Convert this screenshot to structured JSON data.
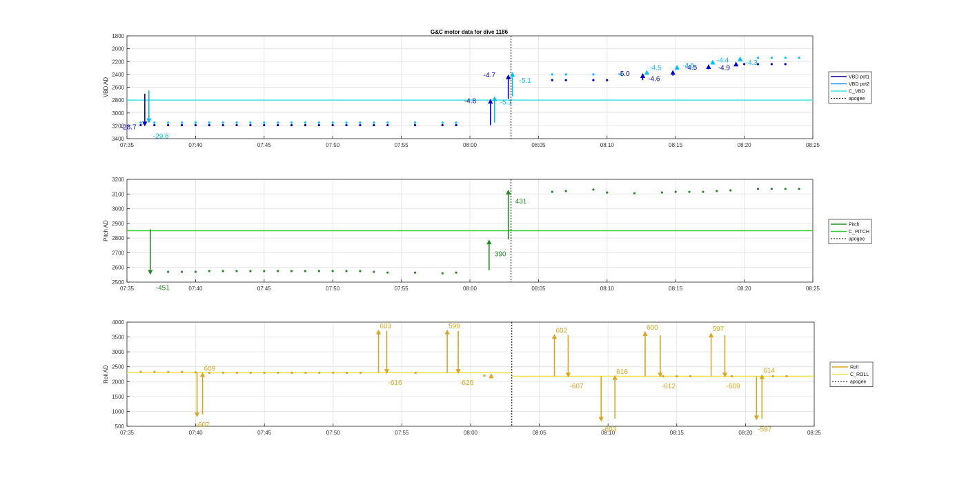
{
  "figure": {
    "title": "G&C motor data for dive 1186"
  },
  "colors": {
    "vbd_pot1": "#00008B",
    "vbd_pot2": "#1E90FF",
    "c_vbd": "#40E0E0",
    "vbd_marker": "#0000CD",
    "vbd_marker2": "#00BFFF",
    "pitch": "#228B22",
    "c_pitch": "#32CD32",
    "roll": "#DAA520",
    "c_roll": "#F5E050",
    "apogee": "#000000",
    "grid": "#e6e6e6",
    "axis": "#262626"
  },
  "chart_data": [
    {
      "type": "line",
      "id": "vbd",
      "ylabel": "VBD AD",
      "xlim": [
        "07:35",
        "08:25"
      ],
      "ylim": [
        1800,
        3400
      ],
      "yreverse": true,
      "xticks": [
        "07:35",
        "07:40",
        "07:45",
        "07:50",
        "07:55",
        "08:00",
        "08:05",
        "08:10",
        "08:15",
        "08:20",
        "08:25"
      ],
      "yticks": [
        1800,
        2000,
        2200,
        2400,
        2600,
        2800,
        3000,
        3200,
        3400
      ],
      "legend": {
        "position": "right",
        "entries": [
          "VBD pot1",
          "VBD pot2",
          "C_VBD",
          "apogee"
        ]
      },
      "reference_line": {
        "name": "C_VBD",
        "value": 2800
      },
      "apogee": "08:03",
      "points_pot1": [
        [
          "07:36",
          3190
        ],
        [
          "07:37",
          3190
        ],
        [
          "07:38",
          3190
        ],
        [
          "07:39",
          3190
        ],
        [
          "07:40",
          3190
        ],
        [
          "07:41",
          3190
        ],
        [
          "07:42",
          3190
        ],
        [
          "07:43",
          3190
        ],
        [
          "07:44",
          3190
        ],
        [
          "07:45",
          3190
        ],
        [
          "07:46",
          3190
        ],
        [
          "07:47",
          3190
        ],
        [
          "07:48",
          3190
        ],
        [
          "07:49",
          3190
        ],
        [
          "07:50",
          3190
        ],
        [
          "07:51",
          3190
        ],
        [
          "07:52",
          3190
        ],
        [
          "07:53",
          3190
        ],
        [
          "07:54",
          3190
        ],
        [
          "07:56",
          3190
        ],
        [
          "07:58",
          3190
        ],
        [
          "07:59",
          3190
        ],
        [
          "08:06",
          2490
        ],
        [
          "08:07",
          2490
        ],
        [
          "08:09",
          2490
        ],
        [
          "08:10",
          2490
        ],
        [
          "08:20",
          2240
        ],
        [
          "08:21",
          2240
        ],
        [
          "08:22",
          2240
        ],
        [
          "08:23",
          2240
        ]
      ],
      "points_pot2": [
        [
          "07:36",
          3150
        ],
        [
          "07:37",
          3150
        ],
        [
          "07:38",
          3150
        ],
        [
          "07:39",
          3150
        ],
        [
          "07:40",
          3150
        ],
        [
          "07:41",
          3150
        ],
        [
          "07:42",
          3150
        ],
        [
          "07:43",
          3150
        ],
        [
          "07:44",
          3150
        ],
        [
          "07:45",
          3150
        ],
        [
          "07:46",
          3150
        ],
        [
          "07:47",
          3150
        ],
        [
          "07:48",
          3150
        ],
        [
          "07:49",
          3150
        ],
        [
          "07:50",
          3150
        ],
        [
          "07:51",
          3150
        ],
        [
          "07:52",
          3150
        ],
        [
          "07:53",
          3150
        ],
        [
          "07:54",
          3150
        ],
        [
          "07:56",
          3150
        ],
        [
          "07:58",
          3150
        ],
        [
          "07:59",
          3150
        ],
        [
          "08:06",
          2400
        ],
        [
          "08:07",
          2400
        ],
        [
          "08:09",
          2400
        ],
        [
          "08:11",
          2400
        ],
        [
          "08:21",
          2140
        ],
        [
          "08:22",
          2140
        ],
        [
          "08:23",
          2140
        ],
        [
          "08:24",
          2140
        ]
      ],
      "arrows": [
        {
          "x": "07:36.3",
          "from": 2700,
          "to": 3210,
          "color": "vbd_marker",
          "label": "-28.7",
          "label_dx": -35,
          "label_dy": 4
        },
        {
          "x": "07:36.6",
          "from": 2650,
          "to": 3160,
          "color": "vbd_marker2",
          "label": "-29.6",
          "label_dx": 6,
          "label_dy": 22
        },
        {
          "x": "08:01.5",
          "from": 3190,
          "to": 2780,
          "color": "vbd_marker",
          "label": "-4.8",
          "label_dx": -38,
          "label_dy": 6
        },
        {
          "x": "08:01.8",
          "from": 3150,
          "to": 2740,
          "color": "vbd_marker2",
          "label": "-5.1",
          "label_dx": 8,
          "label_dy": 12
        },
        {
          "x": "08:02.8",
          "from": 2780,
          "to": 2400,
          "color": "vbd_marker",
          "label": "-4.7",
          "label_dx": -36,
          "label_dy": 4
        },
        {
          "x": "08:03.1",
          "from": 2740,
          "to": 2360,
          "color": "vbd_marker2",
          "label": "-5.1",
          "label_dx": 10,
          "label_dy": 16
        },
        {
          "x": "08:12.6",
          "from": 2490,
          "to": 2380,
          "color": "vbd_marker",
          "label": "-5.0",
          "label_dx": -36,
          "label_dy": 4
        },
        {
          "x": "08:12.9",
          "from": 2400,
          "to": 2330,
          "color": "vbd_marker2",
          "label": "-4.5",
          "label_dx": 4,
          "label_dy": 0
        },
        {
          "x": "08:14.8",
          "from": 2420,
          "to": 2330,
          "color": "vbd_marker",
          "label": "-4.6",
          "label_dx": -36,
          "label_dy": 16
        },
        {
          "x": "08:15.1",
          "from": 2330,
          "to": 2250,
          "color": "vbd_marker2",
          "label": "-4.5",
          "label_dx": 8,
          "label_dy": 4
        },
        {
          "x": "08:17.4",
          "from": 2320,
          "to": 2240,
          "color": "vbd_marker",
          "label": "-4.5",
          "label_dx": -34,
          "label_dy": 8
        },
        {
          "x": "08:17.7",
          "from": 2240,
          "to": 2170,
          "color": "vbd_marker2",
          "label": "-4.4",
          "label_dx": 6,
          "label_dy": 4
        },
        {
          "x": "08:19.4",
          "from": 2270,
          "to": 2200,
          "color": "vbd_marker",
          "label": "-4.9",
          "label_dx": -26,
          "label_dy": 12
        },
        {
          "x": "08:19.7",
          "from": 2200,
          "to": 2120,
          "color": "vbd_marker2",
          "label": "-4.3",
          "label_dx": 8,
          "label_dy": 12
        }
      ]
    },
    {
      "type": "line",
      "id": "pitch",
      "ylabel": "Pitch AD",
      "xlim": [
        "07:35",
        "08:25"
      ],
      "ylim": [
        2500,
        3200
      ],
      "xticks": [
        "07:35",
        "07:40",
        "07:45",
        "07:50",
        "07:55",
        "08:00",
        "08:05",
        "08:10",
        "08:15",
        "08:20",
        "08:25"
      ],
      "yticks": [
        2500,
        2600,
        2700,
        2800,
        2900,
        3000,
        3100,
        3200
      ],
      "legend": {
        "position": "right",
        "entries": [
          "Pitch",
          "C_PITCH",
          "apogee"
        ]
      },
      "reference_line": {
        "name": "C_PITCH",
        "value": 2850
      },
      "apogee": "08:03",
      "points": [
        [
          "07:38",
          2570
        ],
        [
          "07:39",
          2570
        ],
        [
          "07:40",
          2570
        ],
        [
          "07:41",
          2575
        ],
        [
          "07:42",
          2575
        ],
        [
          "07:43",
          2575
        ],
        [
          "07:44",
          2575
        ],
        [
          "07:45",
          2575
        ],
        [
          "07:46",
          2575
        ],
        [
          "07:47",
          2575
        ],
        [
          "07:48",
          2575
        ],
        [
          "07:49",
          2575
        ],
        [
          "07:50",
          2575
        ],
        [
          "07:51",
          2575
        ],
        [
          "07:52",
          2575
        ],
        [
          "07:53",
          2570
        ],
        [
          "07:54",
          2565
        ],
        [
          "07:56",
          2565
        ],
        [
          "07:58",
          2560
        ],
        [
          "07:59",
          2565
        ],
        [
          "08:06",
          3115
        ],
        [
          "08:07",
          3120
        ],
        [
          "08:09",
          3130
        ],
        [
          "08:10",
          3110
        ],
        [
          "08:12",
          3105
        ],
        [
          "08:14",
          3110
        ],
        [
          "08:15",
          3115
        ],
        [
          "08:16",
          3115
        ],
        [
          "08:17",
          3115
        ],
        [
          "08:18",
          3120
        ],
        [
          "08:19",
          3125
        ],
        [
          "08:21",
          3135
        ],
        [
          "08:22",
          3135
        ],
        [
          "08:23",
          3135
        ],
        [
          "08:24",
          3135
        ]
      ],
      "arrows": [
        {
          "x": "07:36.7",
          "from": 2860,
          "to": 2550,
          "color": "pitch",
          "label": "-451",
          "label_dx": 8,
          "label_dy": 22
        },
        {
          "x": "08:01.4",
          "from": 2580,
          "to": 2790,
          "color": "pitch",
          "label": "390",
          "label_dx": 8,
          "label_dy": 24
        },
        {
          "x": "08:02.8",
          "from": 2790,
          "to": 3130,
          "color": "pitch",
          "label": "431",
          "label_dx": 10,
          "label_dy": 20
        }
      ]
    },
    {
      "type": "line",
      "id": "roll",
      "ylabel": "Roll AD",
      "xlim": [
        "07:35",
        "08:25"
      ],
      "ylim": [
        500,
        4000
      ],
      "xticks": [
        "07:35",
        "07:40",
        "07:45",
        "07:50",
        "07:55",
        "08:00",
        "08:05",
        "08:10",
        "08:15",
        "08:20",
        "08:25"
      ],
      "yticks": [
        500,
        1000,
        1500,
        2000,
        2500,
        3000,
        3500,
        4000
      ],
      "legend": {
        "position": "right",
        "entries": [
          "Roll",
          "C_ROLL",
          "apogee"
        ]
      },
      "reference_lines": [
        {
          "name": "C_ROLL",
          "value": 2300,
          "from": "07:35",
          "to": "08:03"
        },
        {
          "name": "C_ROLL",
          "value": 2180,
          "from": "08:03",
          "to": "08:25"
        }
      ],
      "apogee": "08:03",
      "points": [
        [
          "07:36",
          2330
        ],
        [
          "07:37",
          2330
        ],
        [
          "07:38",
          2330
        ],
        [
          "07:39",
          2330
        ],
        [
          "07:40",
          2310
        ],
        [
          "07:41",
          2300
        ],
        [
          "07:42",
          2300
        ],
        [
          "07:43",
          2300
        ],
        [
          "07:44",
          2300
        ],
        [
          "07:45",
          2300
        ],
        [
          "07:46",
          2300
        ],
        [
          "07:47",
          2300
        ],
        [
          "07:48",
          2300
        ],
        [
          "07:49",
          2300
        ],
        [
          "07:50",
          2300
        ],
        [
          "07:51",
          2300
        ],
        [
          "07:52",
          2300
        ],
        [
          "07:56",
          2300
        ],
        [
          "08:01",
          2200
        ],
        [
          "08:14",
          2180
        ],
        [
          "08:15",
          2180
        ],
        [
          "08:16",
          2180
        ],
        [
          "08:19",
          2180
        ],
        [
          "08:22",
          2180
        ],
        [
          "08:23",
          2180
        ]
      ],
      "arrows": [
        {
          "x": "07:40.1",
          "from": 2310,
          "to": 800,
          "color": "roll",
          "label": "-607",
          "label_dx": -2,
          "label_dy": 14
        },
        {
          "x": "07:40.5",
          "from": 900,
          "to": 2320,
          "color": "roll",
          "label": "609",
          "label_dx": 2,
          "label_dy": -2
        },
        {
          "x": "07:53.3",
          "from": 2300,
          "to": 3750,
          "color": "roll",
          "label": "603",
          "label_dx": 2,
          "label_dy": -2
        },
        {
          "x": "07:53.9",
          "from": 3700,
          "to": 2260,
          "color": "roll",
          "label": "-616",
          "label_dx": 2,
          "label_dy": 16
        },
        {
          "x": "07:58.3",
          "from": 2300,
          "to": 3750,
          "color": "roll",
          "label": "599",
          "label_dx": 2,
          "label_dy": -2
        },
        {
          "x": "07:59.1",
          "from": 3700,
          "to": 2260,
          "color": "roll",
          "label": "-626",
          "label_dx": 2,
          "label_dy": 16
        },
        {
          "x": "08:01.5",
          "from": 2100,
          "to": 2280,
          "color": "roll",
          "label": "",
          "label_dx": 0,
          "label_dy": 0
        },
        {
          "x": "08:06.1",
          "from": 2180,
          "to": 3600,
          "color": "roll",
          "label": "602",
          "label_dx": 2,
          "label_dy": -2
        },
        {
          "x": "08:07.1",
          "from": 3560,
          "to": 2140,
          "color": "roll",
          "label": "-607",
          "label_dx": 2,
          "label_dy": 16
        },
        {
          "x": "08:09.5",
          "from": 2180,
          "to": 650,
          "color": "roll",
          "label": "-603",
          "label_dx": 2,
          "label_dy": 14
        },
        {
          "x": "08:10.5",
          "from": 750,
          "to": 2220,
          "color": "roll",
          "label": "616",
          "label_dx": 2,
          "label_dy": -2
        },
        {
          "x": "08:12.7",
          "from": 2180,
          "to": 3700,
          "color": "roll",
          "label": "600",
          "label_dx": 2,
          "label_dy": -2
        },
        {
          "x": "08:13.8",
          "from": 3560,
          "to": 2140,
          "color": "roll",
          "label": "-612",
          "label_dx": 2,
          "label_dy": 16
        },
        {
          "x": "08:17.5",
          "from": 2180,
          "to": 3650,
          "color": "roll",
          "label": "597",
          "label_dx": 2,
          "label_dy": -2
        },
        {
          "x": "08:18.5",
          "from": 3560,
          "to": 2140,
          "color": "roll",
          "label": "-609",
          "label_dx": 2,
          "label_dy": 16
        },
        {
          "x": "08:20.8",
          "from": 2180,
          "to": 700,
          "color": "roll",
          "label": "-597",
          "label_dx": 2,
          "label_dy": 16
        },
        {
          "x": "08:21.2",
          "from": 750,
          "to": 2250,
          "color": "roll",
          "label": "614",
          "label_dx": 2,
          "label_dy": -2
        }
      ]
    }
  ]
}
